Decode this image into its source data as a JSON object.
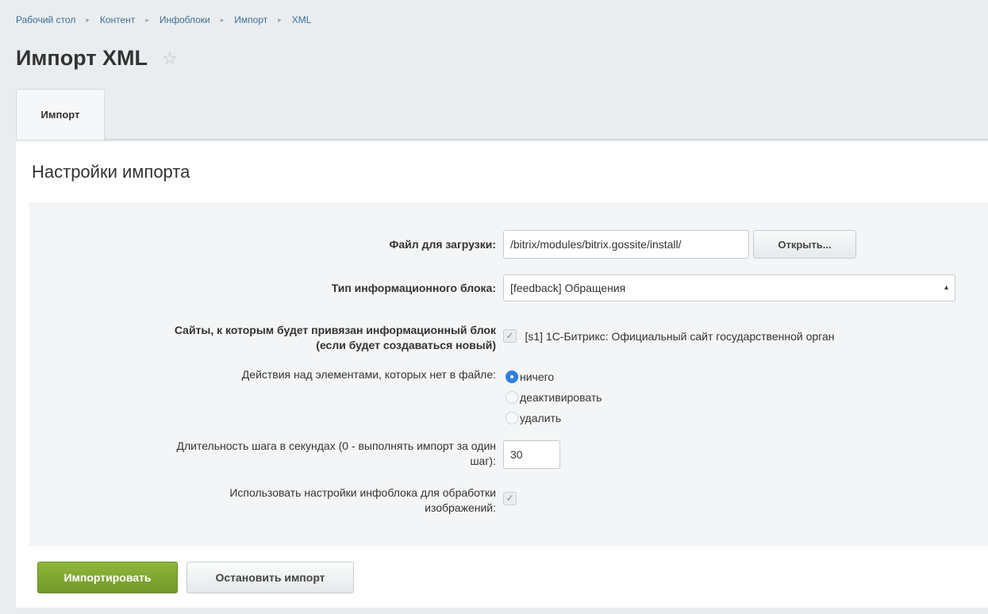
{
  "breadcrumb": {
    "items": [
      "Рабочий стол",
      "Контент",
      "Инфоблоки",
      "Импорт",
      "XML"
    ],
    "separator": "▸"
  },
  "page": {
    "title": "Импорт XML",
    "star_icon": "☆"
  },
  "tabs": [
    {
      "label": "Импорт",
      "active": true
    }
  ],
  "section": {
    "title": "Настройки импорта"
  },
  "form": {
    "file": {
      "label": "Файл для загрузки:",
      "value": "/bitrix/modules/bitrix.gossite/install/",
      "open_button": "Открыть..."
    },
    "iblock_type": {
      "label": "Тип информационного блока:",
      "selected": "[feedback] Обращения"
    },
    "sites": {
      "label_line1": "Сайты, к которым будет привязан информационный блок",
      "label_line2": "(если будет создаваться новый)",
      "option": "[s1] 1С-Битрикс: Официальный сайт государственной орган",
      "checked": true
    },
    "missing_action": {
      "label": "Действия над элементами, которых нет в файле:",
      "options": [
        "ничего",
        "деактивировать",
        "удалить"
      ],
      "selected_index": 0
    },
    "step_duration": {
      "label_line1": "Длительность шага в секундах (0 - выполнять импорт за один",
      "label_line2": "шаг):",
      "value": "30"
    },
    "image_settings": {
      "label_line1": "Использовать настройки инфоблока для обработки",
      "label_line2": "изображений:",
      "checked": true
    }
  },
  "actions": {
    "import_label": "Импортировать",
    "stop_label": "Остановить импорт"
  },
  "colors": {
    "accent_green": "#7ba331",
    "link_blue": "#3f6f9a",
    "radio_blue": "#2f7fd9"
  }
}
